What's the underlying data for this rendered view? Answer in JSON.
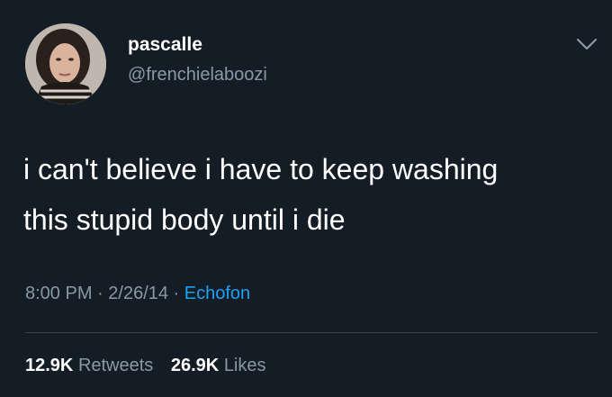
{
  "user": {
    "display_name": "pascalle",
    "handle": "@frenchielaboozi"
  },
  "tweet": {
    "text_line1": "i can't believe i have to keep washing",
    "text_line2": "this stupid body until i die"
  },
  "meta": {
    "time": "8:00 PM",
    "separator1": " · ",
    "date": "2/26/14",
    "separator2": " · ",
    "source": "Echofon"
  },
  "stats": {
    "retweets_count": "12.9K",
    "retweets_label": "Retweets",
    "likes_count": "26.9K",
    "likes_label": "Likes"
  },
  "icons": {
    "menu": "chevron-down-icon"
  },
  "colors": {
    "background": "#141d26",
    "text": "#ffffff",
    "secondary": "#8899a6",
    "link": "#1da1f2",
    "divider": "#38444d"
  }
}
